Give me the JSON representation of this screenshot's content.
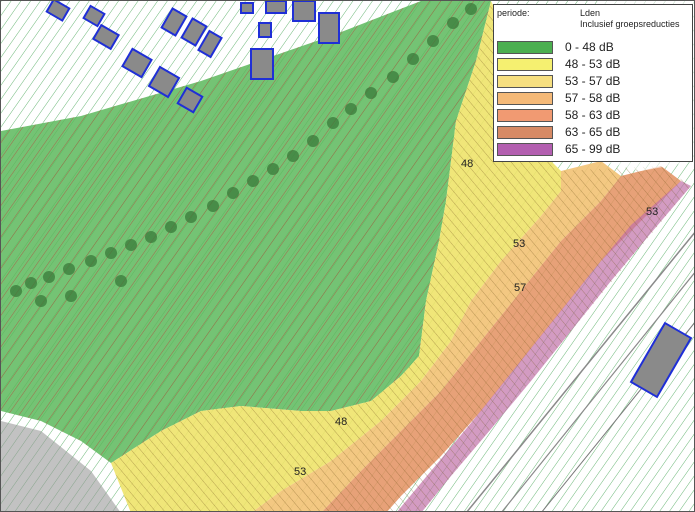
{
  "legend": {
    "period_label": "periode:",
    "period_value_line1": "Lden",
    "period_value_line2": "Inclusief groepsreducties",
    "classes": [
      {
        "label": "0 - 48 dB",
        "color": "#4caf50"
      },
      {
        "label": "48 - 53 dB",
        "color": "#f5f070"
      },
      {
        "label": "53 - 57 dB",
        "color": "#f6df80"
      },
      {
        "label": "57 - 58 dB",
        "color": "#f4b978"
      },
      {
        "label": "58 - 63 dB",
        "color": "#f19a72"
      },
      {
        "label": "63 - 65 dB",
        "color": "#d78a65"
      },
      {
        "label": "65 - 99 dB",
        "color": "#b35fb0"
      }
    ]
  },
  "contour_labels": {
    "label_48_a": "48",
    "label_48_b": "48",
    "label_53_a": "53",
    "label_53_b": "53",
    "label_53_c": "53",
    "label_57": "57"
  },
  "colors": {
    "green_zone": "#5cb85c",
    "yellow_zone": "#eee36a",
    "building_fill": "#8a8a8a",
    "building_stroke": "#1f2fd6",
    "hatch_red": "#b8453a",
    "hatch_green": "#3aa04a"
  }
}
